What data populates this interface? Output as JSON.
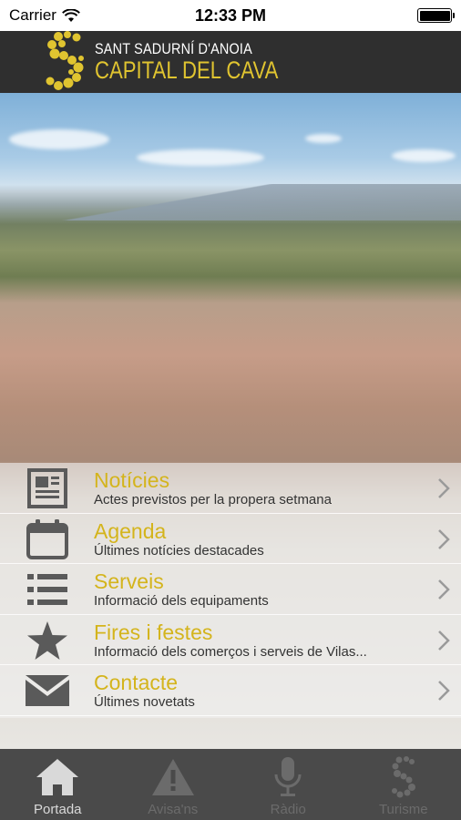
{
  "status_bar": {
    "carrier": "Carrier",
    "time": "12:33 PM"
  },
  "header": {
    "line1": "SANT SADURNÍ D'ANOIA",
    "line2": "CAPITAL DEL CAVA"
  },
  "colors": {
    "accent": "#d4b41c",
    "header_bg": "#2f2f2f",
    "tabbar_bg": "#4a4a4a"
  },
  "menu": {
    "items": [
      {
        "title": "Notícies",
        "subtitle": "Actes previstos per la propera setmana",
        "icon": "newspaper-icon"
      },
      {
        "title": "Agenda",
        "subtitle": "Últimes notícies destacades",
        "icon": "calendar-icon"
      },
      {
        "title": "Serveis",
        "subtitle": "Informació dels equipaments",
        "icon": "list-icon"
      },
      {
        "title": "Fires i festes",
        "subtitle": "Informació dels comerços i serveis de Vilas...",
        "icon": "star-icon"
      },
      {
        "title": "Contacte",
        "subtitle": "Últimes novetats",
        "icon": "envelope-icon"
      }
    ]
  },
  "tabbar": {
    "tabs": [
      {
        "label": "Portada",
        "icon": "home-icon",
        "active": true
      },
      {
        "label": "Avisa'ns",
        "icon": "warning-icon",
        "active": false
      },
      {
        "label": "Ràdio",
        "icon": "microphone-icon",
        "active": false
      },
      {
        "label": "Turisme",
        "icon": "s-logo-icon",
        "active": false
      }
    ]
  }
}
